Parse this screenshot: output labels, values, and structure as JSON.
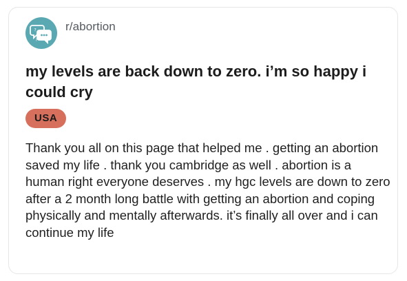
{
  "post": {
    "subreddit": "r/abortion",
    "avatar_icon": "chat-bubbles-icon",
    "avatar_color": "#5aa8b2",
    "title": "my levels are back down to zero. i’m so happy i could cry",
    "flair": {
      "label": "USA",
      "color": "#d6705d"
    },
    "body": "Thank you all on this page that helped me . getting an abortion saved my life . thank you cambridge as well . abortion is a human right everyone deserves . my hgc levels are down to zero after a 2 month long battle with getting an abortion and coping physically and mentally afterwards. it’s finally all over and i can continue my life"
  }
}
